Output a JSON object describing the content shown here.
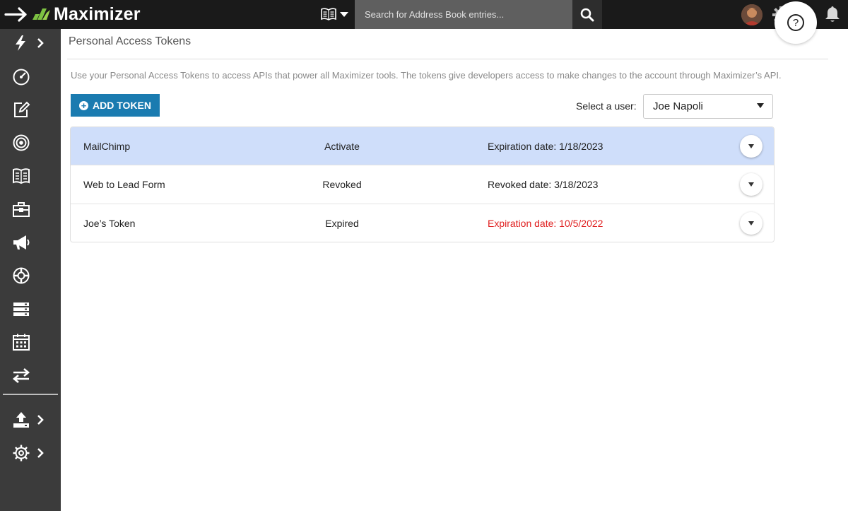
{
  "app": {
    "brand_name": "Maximizer"
  },
  "search": {
    "placeholder": "Search for Address Book entries..."
  },
  "sidebar": {
    "items": [
      {
        "icon": "lightning-icon",
        "has_chevron": true
      },
      {
        "icon": "dashboard-gauge-icon",
        "has_chevron": false
      },
      {
        "icon": "edit-note-icon",
        "has_chevron": false
      },
      {
        "icon": "target-icon",
        "has_chevron": false
      },
      {
        "icon": "address-book-icon",
        "has_chevron": false
      },
      {
        "icon": "briefcase-icon",
        "has_chevron": false
      },
      {
        "icon": "megaphone-icon",
        "has_chevron": false
      },
      {
        "icon": "lifebuoy-icon",
        "has_chevron": false
      },
      {
        "icon": "server-icon",
        "has_chevron": false
      },
      {
        "icon": "calendar-icon",
        "has_chevron": false
      },
      {
        "icon": "transfer-arrows-icon",
        "has_chevron": false
      },
      {
        "icon": "upload-icon",
        "has_chevron": true
      },
      {
        "icon": "settings-gear-icon",
        "has_chevron": true
      }
    ]
  },
  "page": {
    "title": "Personal Access Tokens",
    "description": "Use your Personal Access Tokens to access APIs that power all Maximizer tools. The tokens give developers access to make changes to the account through Maximizer’s API.",
    "add_button_label": "ADD TOKEN",
    "user_select_label": "Select a user:",
    "selected_user": "Joe Napoli"
  },
  "tokens": [
    {
      "name": "MailChimp",
      "status": "Activate",
      "date_text": "Expiration date: 1/18/2023",
      "highlighted": true,
      "expired": false
    },
    {
      "name": "Web to Lead Form",
      "status": "Revoked",
      "date_text": "Revoked date: 3/18/2023",
      "highlighted": false,
      "expired": false
    },
    {
      "name": "Joe’s Token",
      "status": "Expired",
      "date_text": "Expiration date: 10/5/2022",
      "highlighted": false,
      "expired": true
    }
  ],
  "colors": {
    "accent": "#1a7bb0",
    "highlight_row": "#cfdefa",
    "expired_text": "#e02020",
    "topbar": "#1a1a1a",
    "sidebar": "#3b3b3b"
  }
}
